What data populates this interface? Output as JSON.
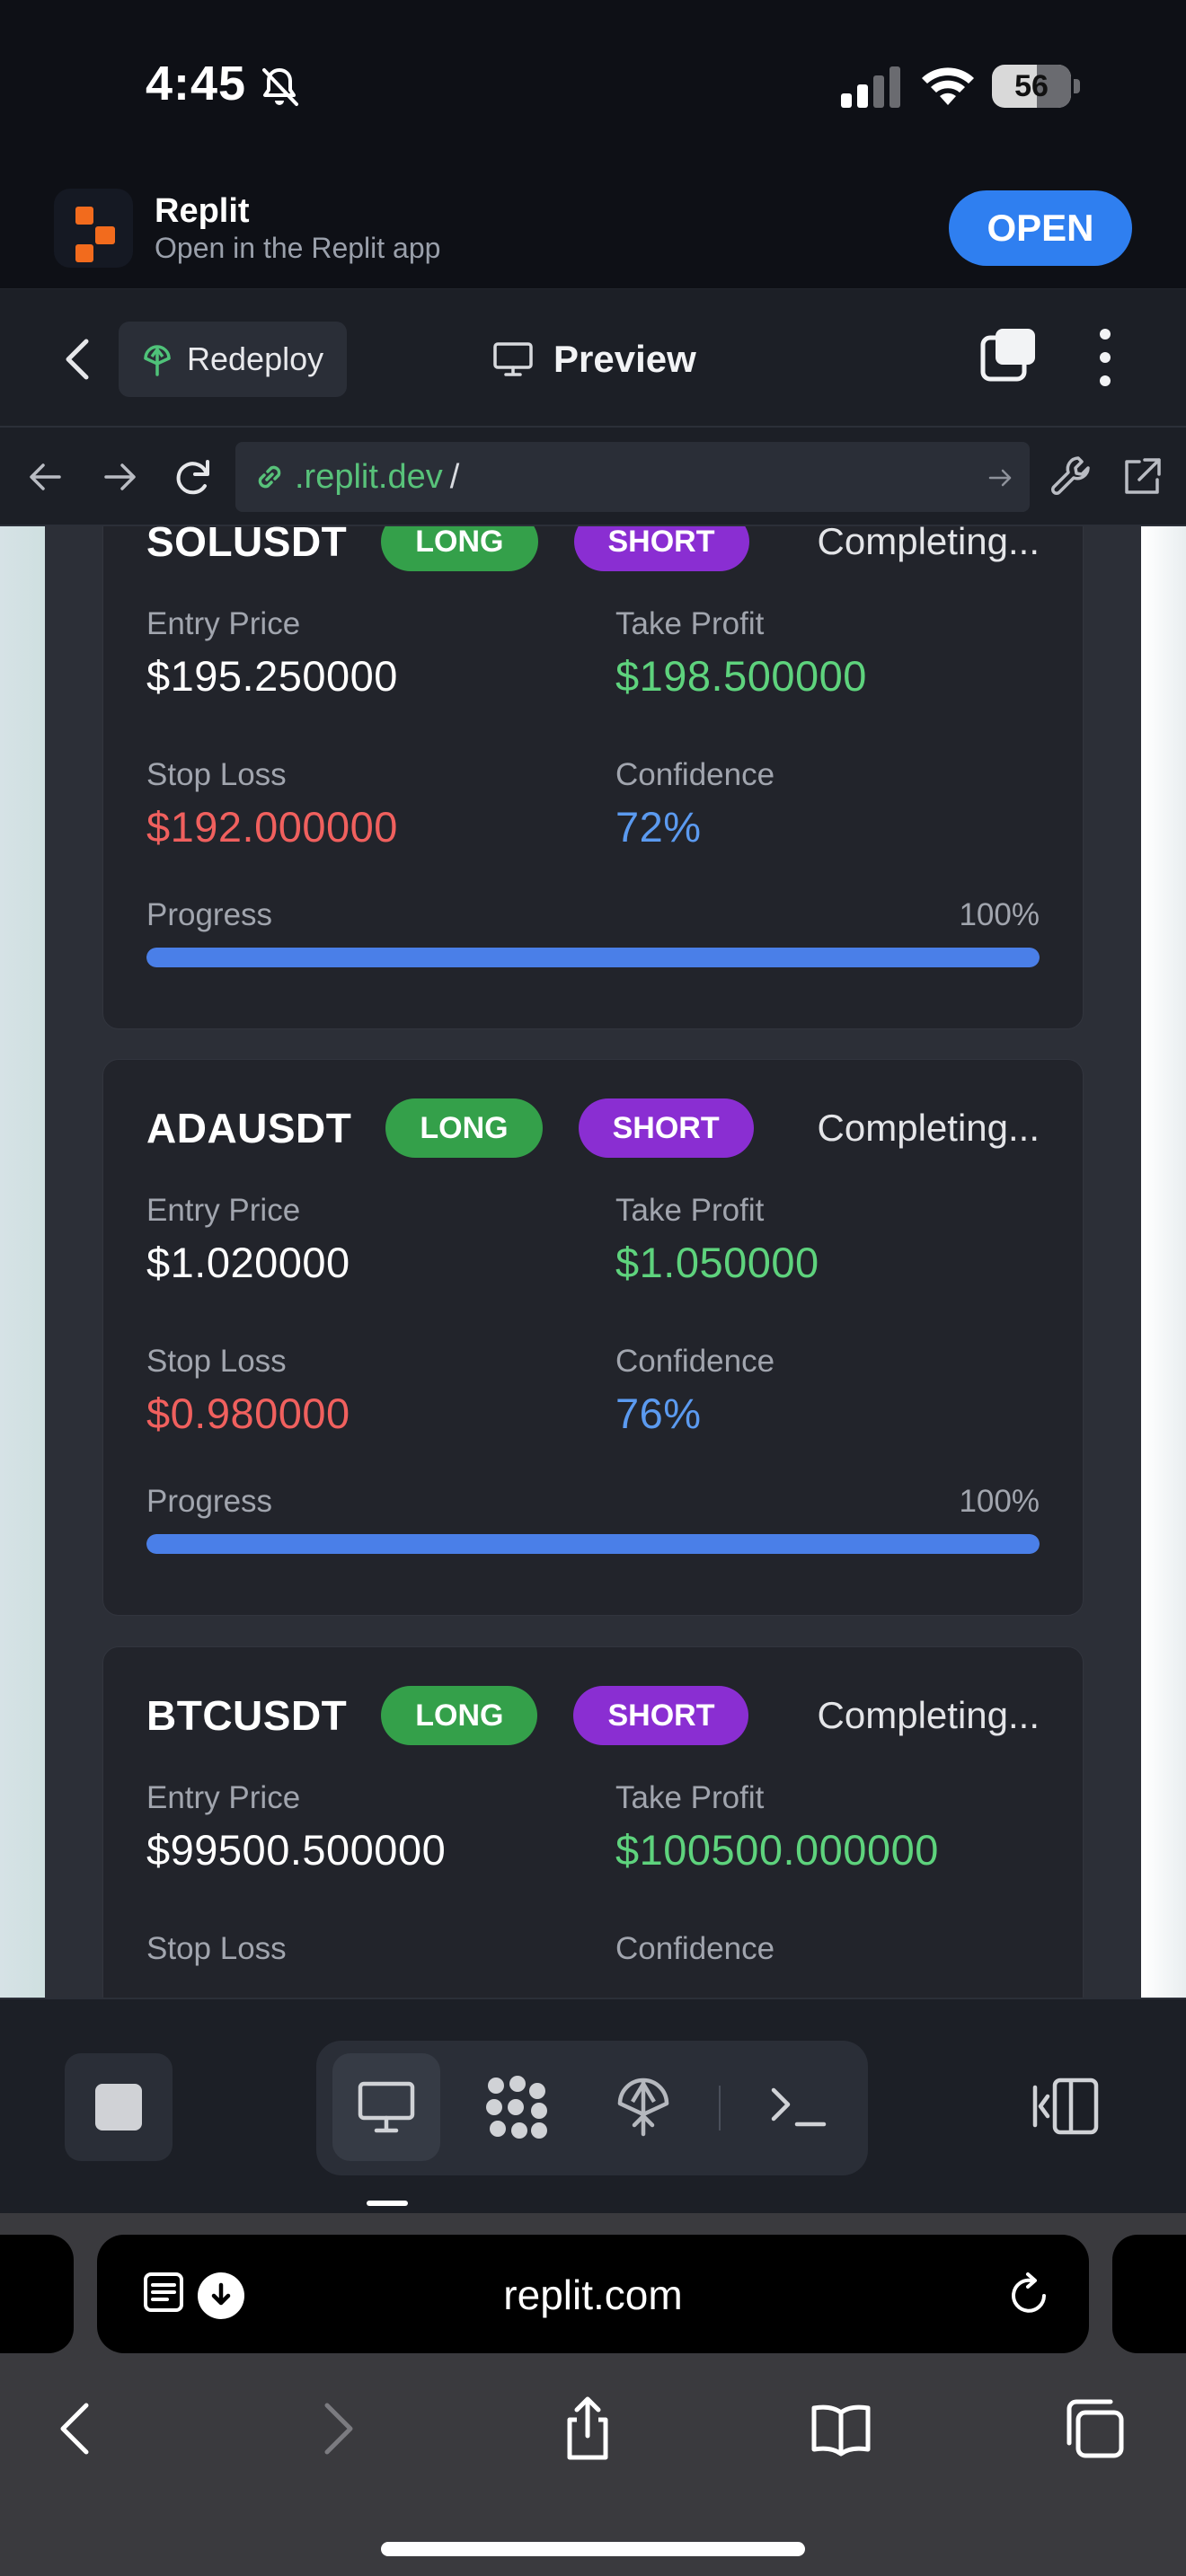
{
  "status_bar": {
    "time": "4:45",
    "battery": "56"
  },
  "app_banner": {
    "name": "Replit",
    "subtitle": "Open in the Replit app",
    "open_label": "OPEN"
  },
  "toolbar": {
    "redeploy_label": "Redeploy",
    "preview_label": "Preview"
  },
  "url_bar": {
    "host": ".replit.dev",
    "path": "/"
  },
  "signals": [
    {
      "pair": "SOLUSDT",
      "long_label": "LONG",
      "short_label": "SHORT",
      "status": "Completing...",
      "entry_label": "Entry Price",
      "entry": "$195.250000",
      "tp_label": "Take Profit",
      "tp": "$198.500000",
      "sl_label": "Stop Loss",
      "sl": "$192.000000",
      "conf_label": "Confidence",
      "confidence": "72%",
      "progress_label": "Progress",
      "progress_text": "100%",
      "progress": 1.0
    },
    {
      "pair": "ADAUSDT",
      "long_label": "LONG",
      "short_label": "SHORT",
      "status": "Completing...",
      "entry_label": "Entry Price",
      "entry": "$1.020000",
      "tp_label": "Take Profit",
      "tp": "$1.050000",
      "sl_label": "Stop Loss",
      "sl": "$0.980000",
      "conf_label": "Confidence",
      "confidence": "76%",
      "progress_label": "Progress",
      "progress_text": "100%",
      "progress": 1.0
    },
    {
      "pair": "BTCUSDT",
      "long_label": "LONG",
      "short_label": "SHORT",
      "status": "Completing...",
      "entry_label": "Entry Price",
      "entry": "$99500.500000",
      "tp_label": "Take Profit",
      "tp": "$100500.000000",
      "sl_label": "Stop Loss",
      "conf_label": "Confidence"
    }
  ],
  "safari": {
    "address": "replit.com"
  },
  "colors": {
    "long": "#34a04a",
    "short": "#8a2ed2",
    "take_profit": "#5ed37d",
    "stop_loss": "#f0605e",
    "confidence": "#5b9af0",
    "progress": "#4a7fe8",
    "accent": "#2f7ff0"
  },
  "icons": [
    "bell-slash-icon",
    "cellular-signal-icon",
    "wifi-icon",
    "battery-icon",
    "replit-logo-icon",
    "back-chevron-icon",
    "deploy-icon",
    "monitor-icon",
    "tabs-icon",
    "more-vertical-icon",
    "arrow-left-icon",
    "arrow-right-icon",
    "reload-icon",
    "link-icon",
    "go-arrow-icon",
    "wrench-icon",
    "external-link-icon",
    "stop-icon",
    "desktop-icon",
    "grid-dots-icon",
    "deployments-icon",
    "terminal-icon",
    "split-view-icon",
    "reader-icon",
    "download-icon",
    "share-icon",
    "bookmarks-icon",
    "tabs-overview-icon"
  ]
}
